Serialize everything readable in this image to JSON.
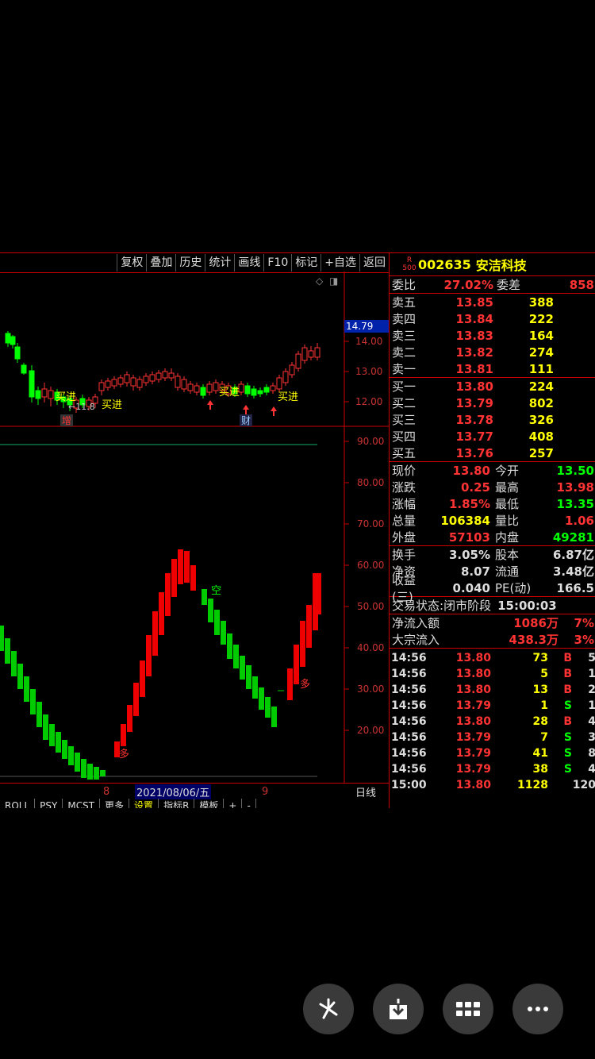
{
  "toolbar": {
    "items": [
      "复权",
      "叠加",
      "历史",
      "统计",
      "画线",
      "F10",
      "标记",
      "+自选",
      "返回"
    ]
  },
  "chart_markers": {
    "diamond": "◇",
    "box": "◨"
  },
  "main_chart": {
    "price_axis": [
      "14.00",
      "13.00",
      "12.00"
    ],
    "current_price_tag": "14.79",
    "labels": {
      "buy1": "买进",
      "buy2": "买进",
      "buy3": "买进",
      "buy4": "买进",
      "arrow_price": "←11.8",
      "zeng": "增",
      "cai": "财"
    }
  },
  "sub_chart": {
    "axis": [
      "90.00",
      "80.00",
      "70.00",
      "60.00",
      "50.00",
      "40.00",
      "30.00",
      "20.00"
    ],
    "labels": {
      "duo1": "多",
      "kong": "空",
      "duo2": "多"
    }
  },
  "date_bar": {
    "tick1": "8",
    "date": "2021/08/06/五",
    "tick2": "9",
    "period": "日线"
  },
  "bottom_tabs": [
    "ROLL",
    "PSY",
    "MCST",
    "更多",
    "设置",
    "指标R",
    "模板",
    "+",
    "-"
  ],
  "quote": {
    "badge_top": "R",
    "badge_bottom": "500",
    "code": "002635",
    "name": "安洁科技",
    "weibi_label": "委比",
    "weibi": "27.02%",
    "weicha_label": "委差",
    "weicha": "858",
    "sells": [
      {
        "label": "卖五",
        "price": "13.85",
        "vol": "388"
      },
      {
        "label": "卖四",
        "price": "13.84",
        "vol": "222"
      },
      {
        "label": "卖三",
        "price": "13.83",
        "vol": "164"
      },
      {
        "label": "卖二",
        "price": "13.82",
        "vol": "274"
      },
      {
        "label": "卖一",
        "price": "13.81",
        "vol": "111"
      }
    ],
    "buys": [
      {
        "label": "买一",
        "price": "13.80",
        "vol": "224"
      },
      {
        "label": "买二",
        "price": "13.79",
        "vol": "802"
      },
      {
        "label": "买三",
        "price": "13.78",
        "vol": "326"
      },
      {
        "label": "买四",
        "price": "13.77",
        "vol": "408"
      },
      {
        "label": "买五",
        "price": "13.76",
        "vol": "257"
      }
    ],
    "stats1": [
      {
        "k": "现价",
        "v": "13.80",
        "vc": "red",
        "k2": "今开",
        "v2": "13.50",
        "v2c": "green"
      },
      {
        "k": "涨跌",
        "v": "0.25",
        "vc": "red",
        "k2": "最高",
        "v2": "13.98",
        "v2c": "red"
      },
      {
        "k": "涨幅",
        "v": "1.85%",
        "vc": "red",
        "k2": "最低",
        "v2": "13.35",
        "v2c": "green"
      },
      {
        "k": "总量",
        "v": "106384",
        "vc": "yel",
        "k2": "量比",
        "v2": "1.06",
        "v2c": "red"
      },
      {
        "k": "外盘",
        "v": "57103",
        "vc": "red",
        "k2": "内盘",
        "v2": "49281",
        "v2c": "green"
      }
    ],
    "stats2": [
      {
        "k": "换手",
        "v": "3.05%",
        "vc": "wht",
        "k2": "股本",
        "v2": "6.87亿",
        "v2c": "wht"
      },
      {
        "k": "净资",
        "v": "8.07",
        "vc": "wht",
        "k2": "流通",
        "v2": "3.48亿",
        "v2c": "wht"
      },
      {
        "k": "收益(三)",
        "v": "0.040",
        "vc": "wht",
        "k2": "PE(动)",
        "v2": "166.5",
        "v2c": "wht"
      }
    ],
    "status_label": "交易状态:",
    "status_value": "闭市阶段",
    "status_time": "15:00:03",
    "flow": [
      {
        "k": "净流入额",
        "v": "1086万",
        "p": "7%"
      },
      {
        "k": "大宗流入",
        "v": "438.3万",
        "p": "3%"
      }
    ],
    "ticks": [
      {
        "t": "14:56",
        "p": "13.80",
        "pc": "red",
        "n": "73",
        "bs": "B",
        "bsc": "red",
        "x": "5"
      },
      {
        "t": "14:56",
        "p": "13.80",
        "pc": "red",
        "n": "5",
        "bs": "B",
        "bsc": "red",
        "x": "1"
      },
      {
        "t": "14:56",
        "p": "13.80",
        "pc": "red",
        "n": "13",
        "bs": "B",
        "bsc": "red",
        "x": "2"
      },
      {
        "t": "14:56",
        "p": "13.79",
        "pc": "red",
        "n": "1",
        "bs": "S",
        "bsc": "green",
        "x": "1"
      },
      {
        "t": "14:56",
        "p": "13.80",
        "pc": "red",
        "n": "28",
        "bs": "B",
        "bsc": "red",
        "x": "4"
      },
      {
        "t": "14:56",
        "p": "13.79",
        "pc": "red",
        "n": "7",
        "bs": "S",
        "bsc": "green",
        "x": "3"
      },
      {
        "t": "14:56",
        "p": "13.79",
        "pc": "red",
        "n": "41",
        "bs": "S",
        "bsc": "green",
        "x": "8"
      },
      {
        "t": "14:56",
        "p": "13.79",
        "pc": "red",
        "n": "38",
        "bs": "S",
        "bsc": "green",
        "x": "4"
      },
      {
        "t": "15:00",
        "p": "13.80",
        "pc": "red",
        "n": "1128",
        "nc": "mag",
        "bs": "",
        "bsc": "red",
        "x": "120"
      }
    ]
  },
  "fabs": [
    {
      "name": "pinwheel-icon"
    },
    {
      "name": "download-icon"
    },
    {
      "name": "grid-icon"
    },
    {
      "name": "more-icon"
    }
  ]
}
